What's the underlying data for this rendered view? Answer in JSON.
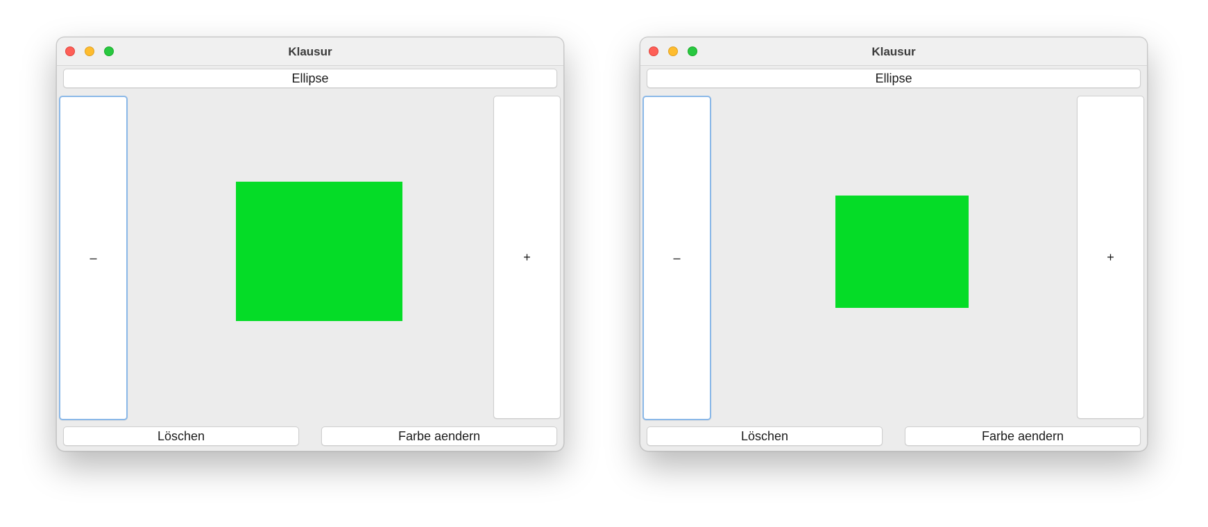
{
  "windows": [
    {
      "title": "Klausur",
      "top_button": "Ellipse",
      "minus_label": "–",
      "plus_label": "+",
      "clear_label": "Löschen",
      "color_label": "Farbe aendern",
      "shape_color": "#05dc27"
    },
    {
      "title": "Klausur",
      "top_button": "Ellipse",
      "minus_label": "–",
      "plus_label": "+",
      "clear_label": "Löschen",
      "color_label": "Farbe aendern",
      "shape_color": "#05dc27"
    }
  ]
}
